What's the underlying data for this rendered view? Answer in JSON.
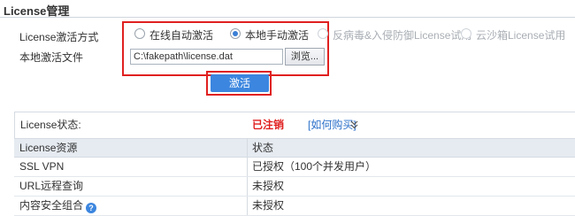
{
  "section_title": "License管理",
  "activation": {
    "method_label": "License激活方式",
    "options": [
      {
        "label": "在线自动激活",
        "selected": false,
        "disabled": false
      },
      {
        "label": "本地手动激活",
        "selected": true,
        "disabled": false
      },
      {
        "label": "反病毒&入侵防御License试用",
        "selected": false,
        "disabled": true
      },
      {
        "label": "云沙箱License试用",
        "selected": false,
        "disabled": true
      }
    ],
    "file_label": "本地激活文件",
    "file_value": "C:\\fakepath\\license.dat",
    "browse_label": "浏览...",
    "activate_label": "激活"
  },
  "status": {
    "label": "License状态:",
    "value": "已注销",
    "value_color": "#e02020",
    "buy_link": "[如何购买]",
    "expand_icon": "double-chevron-down-icon"
  },
  "table": {
    "headers": [
      "License资源",
      "状态"
    ],
    "rows": [
      {
        "resource": "SSL VPN",
        "status": "已授权（100个并发用户）",
        "help": false
      },
      {
        "resource": "URL远程查询",
        "status": "未授权",
        "help": false
      },
      {
        "resource": "内容安全组合",
        "status": "未授权",
        "help": true
      }
    ]
  }
}
